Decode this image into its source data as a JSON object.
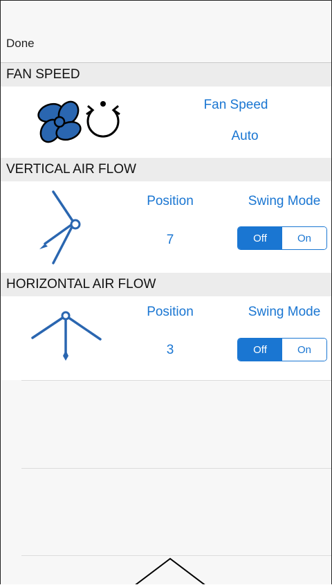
{
  "nav": {
    "done_label": "Done"
  },
  "fan_speed": {
    "header": "FAN SPEED",
    "label": "Fan Speed",
    "value": "Auto"
  },
  "vertical": {
    "header": "VERTICAL AIR FLOW",
    "position_label": "Position",
    "position_value": "7",
    "swing_label": "Swing Mode",
    "swing_off": "Off",
    "swing_on": "On",
    "swing_selected": "Off"
  },
  "horizontal": {
    "header": "HORIZONTAL AIR FLOW",
    "position_label": "Position",
    "position_value": "3",
    "swing_label": "Swing Mode",
    "swing_off": "Off",
    "swing_on": "On",
    "swing_selected": "Off"
  },
  "colors": {
    "accent": "#1a76d2",
    "icon_blue": "#2a66b0"
  }
}
